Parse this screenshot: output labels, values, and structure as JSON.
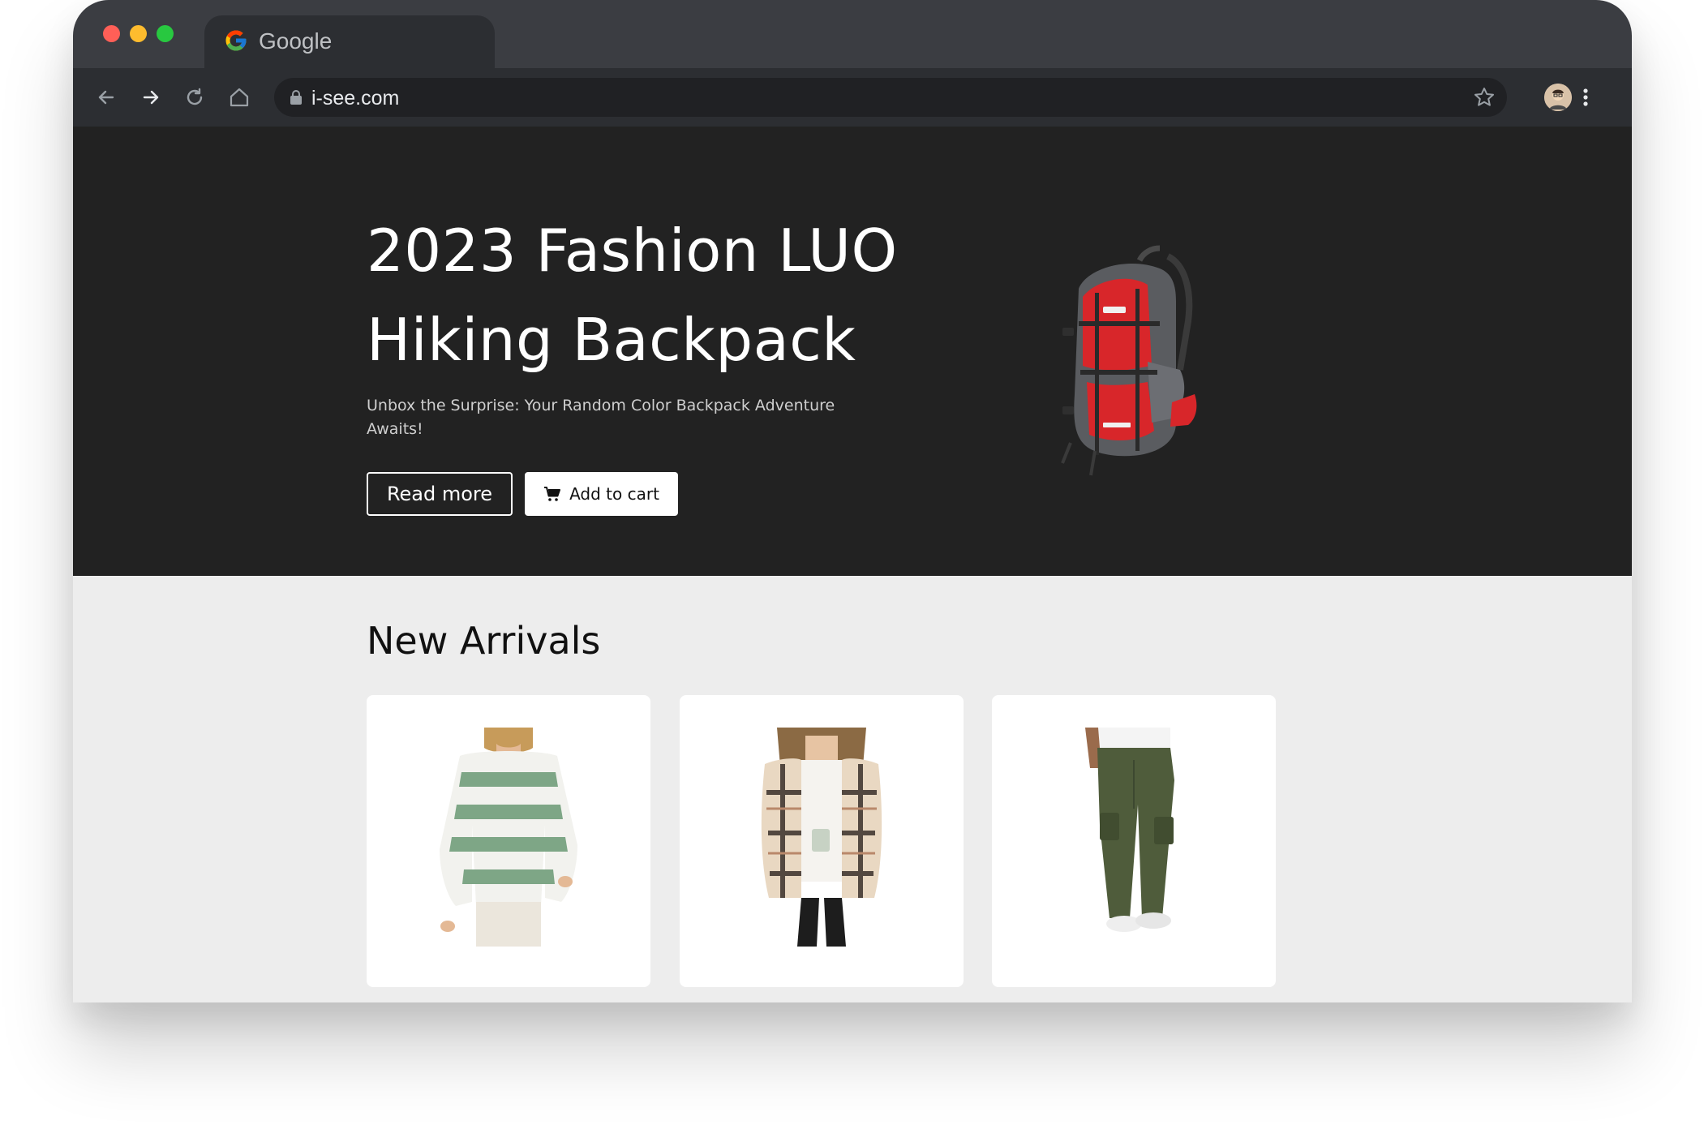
{
  "browser": {
    "tab_title": "Google",
    "url": "i-see.com"
  },
  "hero": {
    "title": "2023 Fashion LUO Hiking Backpack",
    "subtitle": "Unbox the Surprise: Your Random Color Backpack Adventure Awaits!",
    "read_more_label": "Read more",
    "add_to_cart_label": "Add to cart"
  },
  "new_arrivals": {
    "title": "New Arrivals",
    "products": [
      {
        "name": "striped-sweater"
      },
      {
        "name": "plaid-shirt-jacket"
      },
      {
        "name": "cargo-pants"
      }
    ]
  },
  "colors": {
    "hero_bg": "#222222",
    "page_bg": "#ededed",
    "chrome_tabstrip": "#3b3d42",
    "chrome_toolbar": "#2c2e32"
  }
}
